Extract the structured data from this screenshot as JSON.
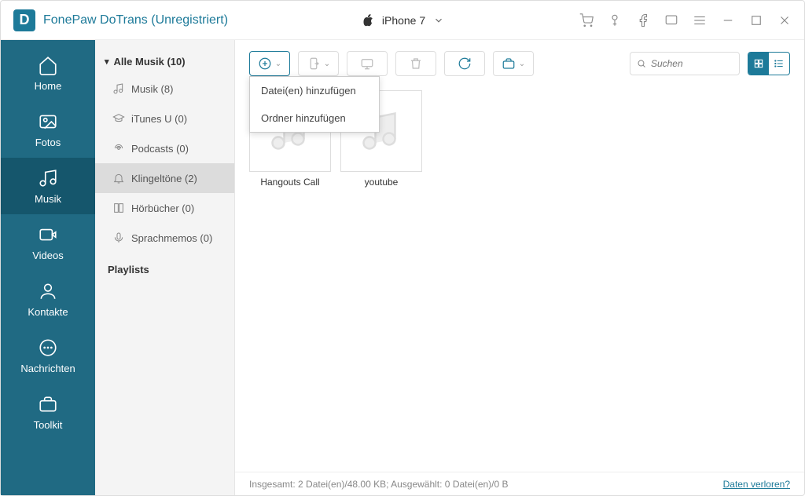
{
  "app": {
    "title": "FonePaw DoTrans (Unregistriert)",
    "device": "iPhone 7"
  },
  "sidebar": {
    "items": [
      {
        "label": "Home"
      },
      {
        "label": "Fotos"
      },
      {
        "label": "Musik"
      },
      {
        "label": "Videos"
      },
      {
        "label": "Kontakte"
      },
      {
        "label": "Nachrichten"
      },
      {
        "label": "Toolkit"
      }
    ]
  },
  "subpanel": {
    "header": "Alle Musik (10)",
    "items": [
      {
        "label": "Musik (8)"
      },
      {
        "label": "iTunes U (0)"
      },
      {
        "label": "Podcasts (0)"
      },
      {
        "label": "Klingeltöne (2)"
      },
      {
        "label": "Hörbücher (0)"
      },
      {
        "label": "Sprachmemos (0)"
      }
    ],
    "playlists_header": "Playlists"
  },
  "dropdown": {
    "add_files": "Datei(en) hinzufügen",
    "add_folder": "Ordner hinzufügen"
  },
  "search": {
    "placeholder": "Suchen"
  },
  "items": [
    {
      "label": "Hangouts Call"
    },
    {
      "label": "youtube"
    }
  ],
  "status": {
    "text": "Insgesamt: 2 Datei(en)/48.00 KB; Ausgewählt: 0 Datei(en)/0 B",
    "link": "Daten verloren?"
  }
}
